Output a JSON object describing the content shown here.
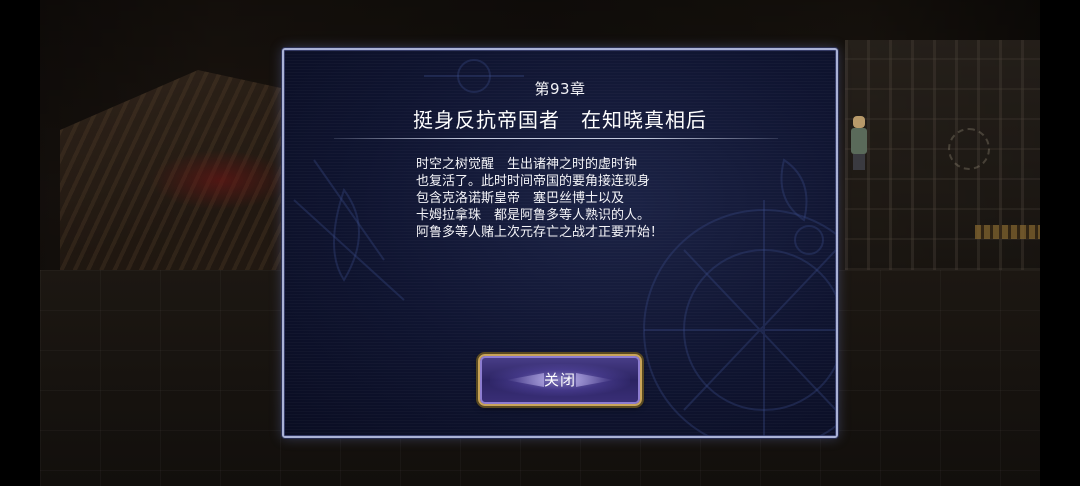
{
  "dialog": {
    "chapter": "第93章",
    "title": "挺身反抗帝国者　在知晓真相后",
    "body_lines": [
      "时空之树觉醒　生出诸神之时的虚时钟",
      "也复活了。此时时间帝国的要角接连现身",
      "包含克洛诺斯皇帝　塞巴丝博士以及",
      "卡姆拉拿珠　都是阿鲁多等人熟识的人。",
      "阿鲁多等人赌上次元存亡之战才正要开始！"
    ],
    "close_label": "关闭"
  },
  "colors": {
    "dialog_border": "#aab2d6",
    "dialog_bg": "#0f1430",
    "button_border": "#c9a45a",
    "button_fill": "#2c2463",
    "text": "#ffffff"
  },
  "icons": {
    "decoration": "clock-sigil-ornament"
  }
}
